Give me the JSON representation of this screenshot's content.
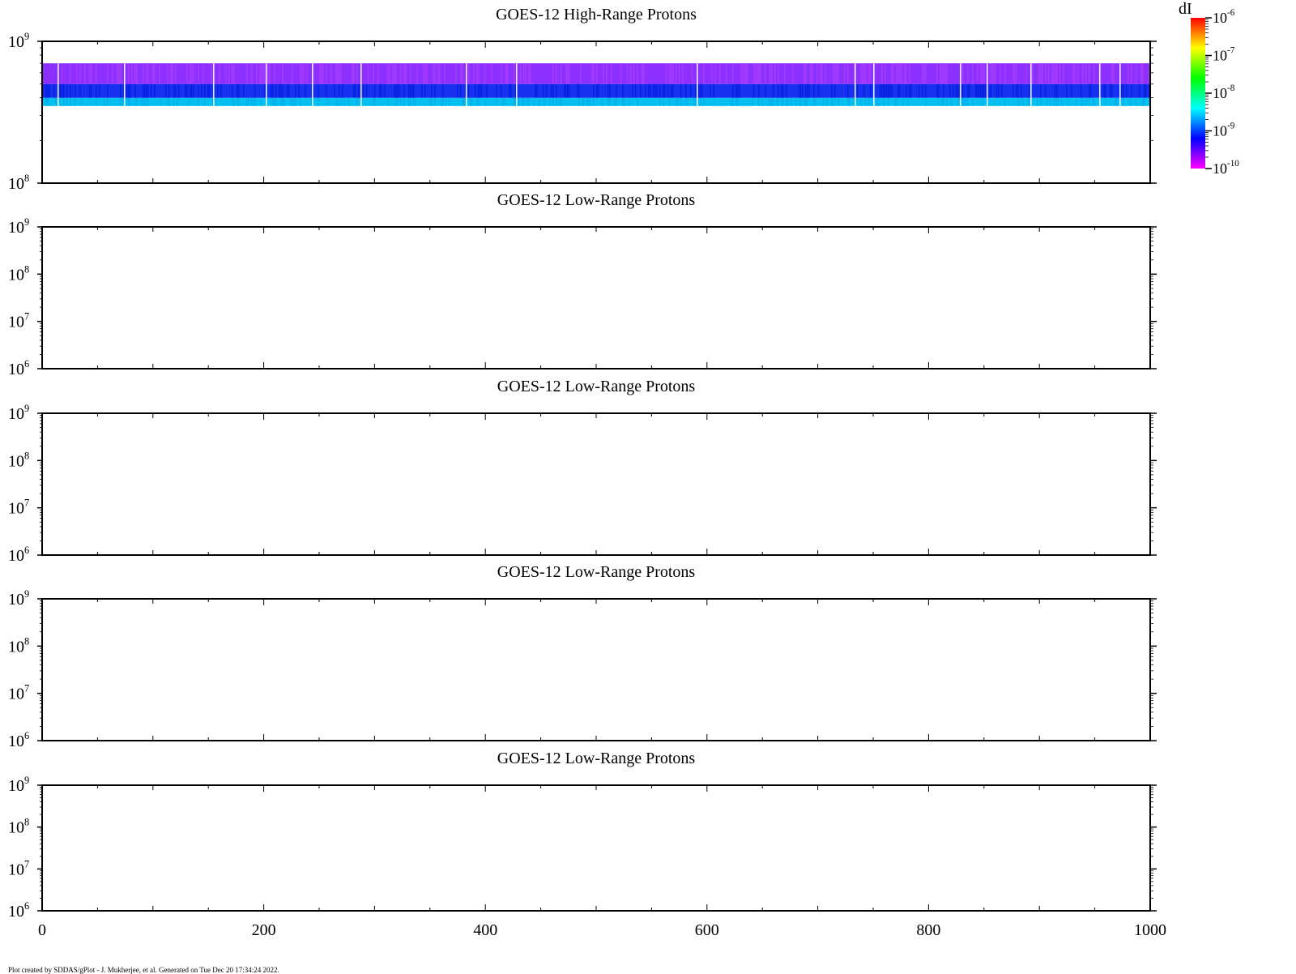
{
  "chart_data": [
    {
      "type": "heatmap",
      "title": "GOES-12 High-Range Protons",
      "xlim": [
        0,
        1000
      ],
      "ylim": [
        100000000,
        1000000000
      ],
      "yscale": "log",
      "yticks": [
        "10|8",
        "10|9"
      ],
      "bands": [
        {
          "y": [
            350000000,
            400000000
          ],
          "level": -9.0,
          "color": "#00c0f0"
        },
        {
          "y": [
            400000000,
            500000000
          ],
          "level": -9.6,
          "color": "#1830f0"
        },
        {
          "y": [
            500000000,
            700000000
          ],
          "level": -9.9,
          "color": "#8c30ff"
        }
      ],
      "gap_x": [
        71,
        153,
        263,
        328,
        385,
        445,
        575,
        637,
        860,
        1055,
        1078,
        1185,
        1218,
        1272,
        1357,
        1382
      ]
    },
    {
      "type": "heatmap",
      "title": "GOES-12 Low-Range Protons",
      "xlim": [
        0,
        1000
      ],
      "ylim": [
        1000000,
        1000000000
      ],
      "yscale": "log",
      "yticks": [
        "10|6",
        "10|7",
        "10|8",
        "10|9"
      ],
      "bands": []
    },
    {
      "type": "heatmap",
      "title": "GOES-12 Low-Range Protons",
      "xlim": [
        0,
        1000
      ],
      "ylim": [
        1000000,
        1000000000
      ],
      "yscale": "log",
      "yticks": [
        "10|6",
        "10|7",
        "10|8",
        "10|9"
      ],
      "bands": []
    },
    {
      "type": "heatmap",
      "title": "GOES-12 Low-Range Protons",
      "xlim": [
        0,
        1000
      ],
      "ylim": [
        1000000,
        1000000000
      ],
      "yscale": "log",
      "yticks": [
        "10|6",
        "10|7",
        "10|8",
        "10|9"
      ],
      "bands": []
    },
    {
      "type": "heatmap",
      "title": "GOES-12 Low-Range Protons",
      "xlim": [
        0,
        1000
      ],
      "ylim": [
        1000000,
        1000000000
      ],
      "yscale": "log",
      "yticks": [
        "10|6",
        "10|7",
        "10|8",
        "10|9"
      ],
      "xticks": [
        "0",
        "200",
        "400",
        "600",
        "800",
        "1000"
      ],
      "bands": []
    }
  ],
  "colorbar": {
    "label": "dI",
    "range": [
      -10,
      -6
    ],
    "ticks": [
      "10|-6",
      "10|-7",
      "10|-8",
      "10|-9",
      "10|-10"
    ],
    "stops": [
      "#ff00ff",
      "#0000ff",
      "#00ffff",
      "#00ff00",
      "#ffff00",
      "#ff0000"
    ]
  },
  "footer": "Plot created by SDDAS/gPlot - J. Mukherjee, et al.  Generated on Tue Dec 20 17:34:24 2022."
}
